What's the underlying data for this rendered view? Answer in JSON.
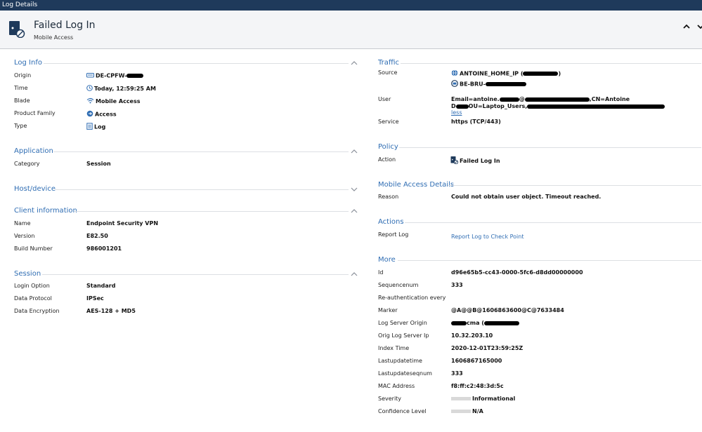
{
  "window": {
    "title": "Log Details"
  },
  "header": {
    "title": "Failed Log In",
    "subtitle": "Mobile Access"
  },
  "sections": {
    "log_info": {
      "title": "Log Info",
      "rows": [
        {
          "label": "Origin",
          "value": "DE-CPFW-"
        },
        {
          "label": "Time",
          "value": "Today, 12:59:25 AM"
        },
        {
          "label": "Blade",
          "value": "Mobile Access"
        },
        {
          "label": "Product Family",
          "value": "Access"
        },
        {
          "label": "Type",
          "value": "Log"
        }
      ]
    },
    "application": {
      "title": "Application",
      "rows": [
        {
          "label": "Category",
          "value": "Session"
        }
      ]
    },
    "host_device": {
      "title": "Host/device"
    },
    "client_information": {
      "title": "Client information",
      "rows": [
        {
          "label": "Name",
          "value": "Endpoint Security VPN"
        },
        {
          "label": "Version",
          "value": "E82.50"
        },
        {
          "label": "Build Number",
          "value": "986001201"
        }
      ]
    },
    "session": {
      "title": "Session",
      "rows": [
        {
          "label": "Login Option",
          "value": "Standard"
        },
        {
          "label": "Data Protocol",
          "value": "IPSec"
        },
        {
          "label": "Data Encryption",
          "value": "AES-128 + MD5"
        }
      ]
    },
    "traffic": {
      "title": "Traffic",
      "source_label": "Source",
      "source_line1": "ANTOINE_HOME_IP (",
      "source_line1_end": ")",
      "source_line2": "BE-BRU-",
      "user_label": "User",
      "user_line1_a": "Email=antoine.",
      "user_line1_b": "@",
      "user_line1_c": ",CN=Antoine",
      "user_line2_a": "D",
      "user_line2_b": "OU=Laptop_Users,",
      "user_less": "less",
      "service_label": "Service",
      "service_value": "https (TCP/443)"
    },
    "policy": {
      "title": "Policy",
      "rows": [
        {
          "label": "Action",
          "value": "Failed Log In"
        }
      ]
    },
    "mobile_access_details": {
      "title": "Mobile Access Details",
      "rows": [
        {
          "label": "Reason",
          "value": "Could not obtain user object. Timeout reached."
        }
      ]
    },
    "actions": {
      "title": "Actions",
      "rows": [
        {
          "label": "Report Log",
          "value": "Report Log to Check Point"
        }
      ]
    },
    "more": {
      "title": "More",
      "rows": [
        {
          "label": "Id",
          "value": "d96e65b5-cc43-0000-5fc6-d8dd00000000"
        },
        {
          "label": "Sequencenum",
          "value": "333"
        },
        {
          "label": "Re-authentication every",
          "value": ""
        },
        {
          "label": "Marker",
          "value": "@A@@B@1606863600@C@7633484"
        },
        {
          "label": "Log Server Origin",
          "value": "cma ("
        },
        {
          "label": "Orig Log Server Ip",
          "value": "10.32.203.10"
        },
        {
          "label": "Index Time",
          "value": "2020-12-01T23:59:25Z"
        },
        {
          "label": "Lastupdatetime",
          "value": "1606867165000"
        },
        {
          "label": "Lastupdateseqnum",
          "value": "333"
        },
        {
          "label": "MAC Address",
          "value": "f8:ff:c2:48:3d:5c"
        },
        {
          "label": "Severity",
          "value": "Informational"
        },
        {
          "label": "Confidence Level",
          "value": "N/A"
        }
      ]
    }
  },
  "colors": {
    "titlebar": "#1f3a5b",
    "accent": "#2f6db3",
    "header_bg": "#f4f5f7"
  }
}
